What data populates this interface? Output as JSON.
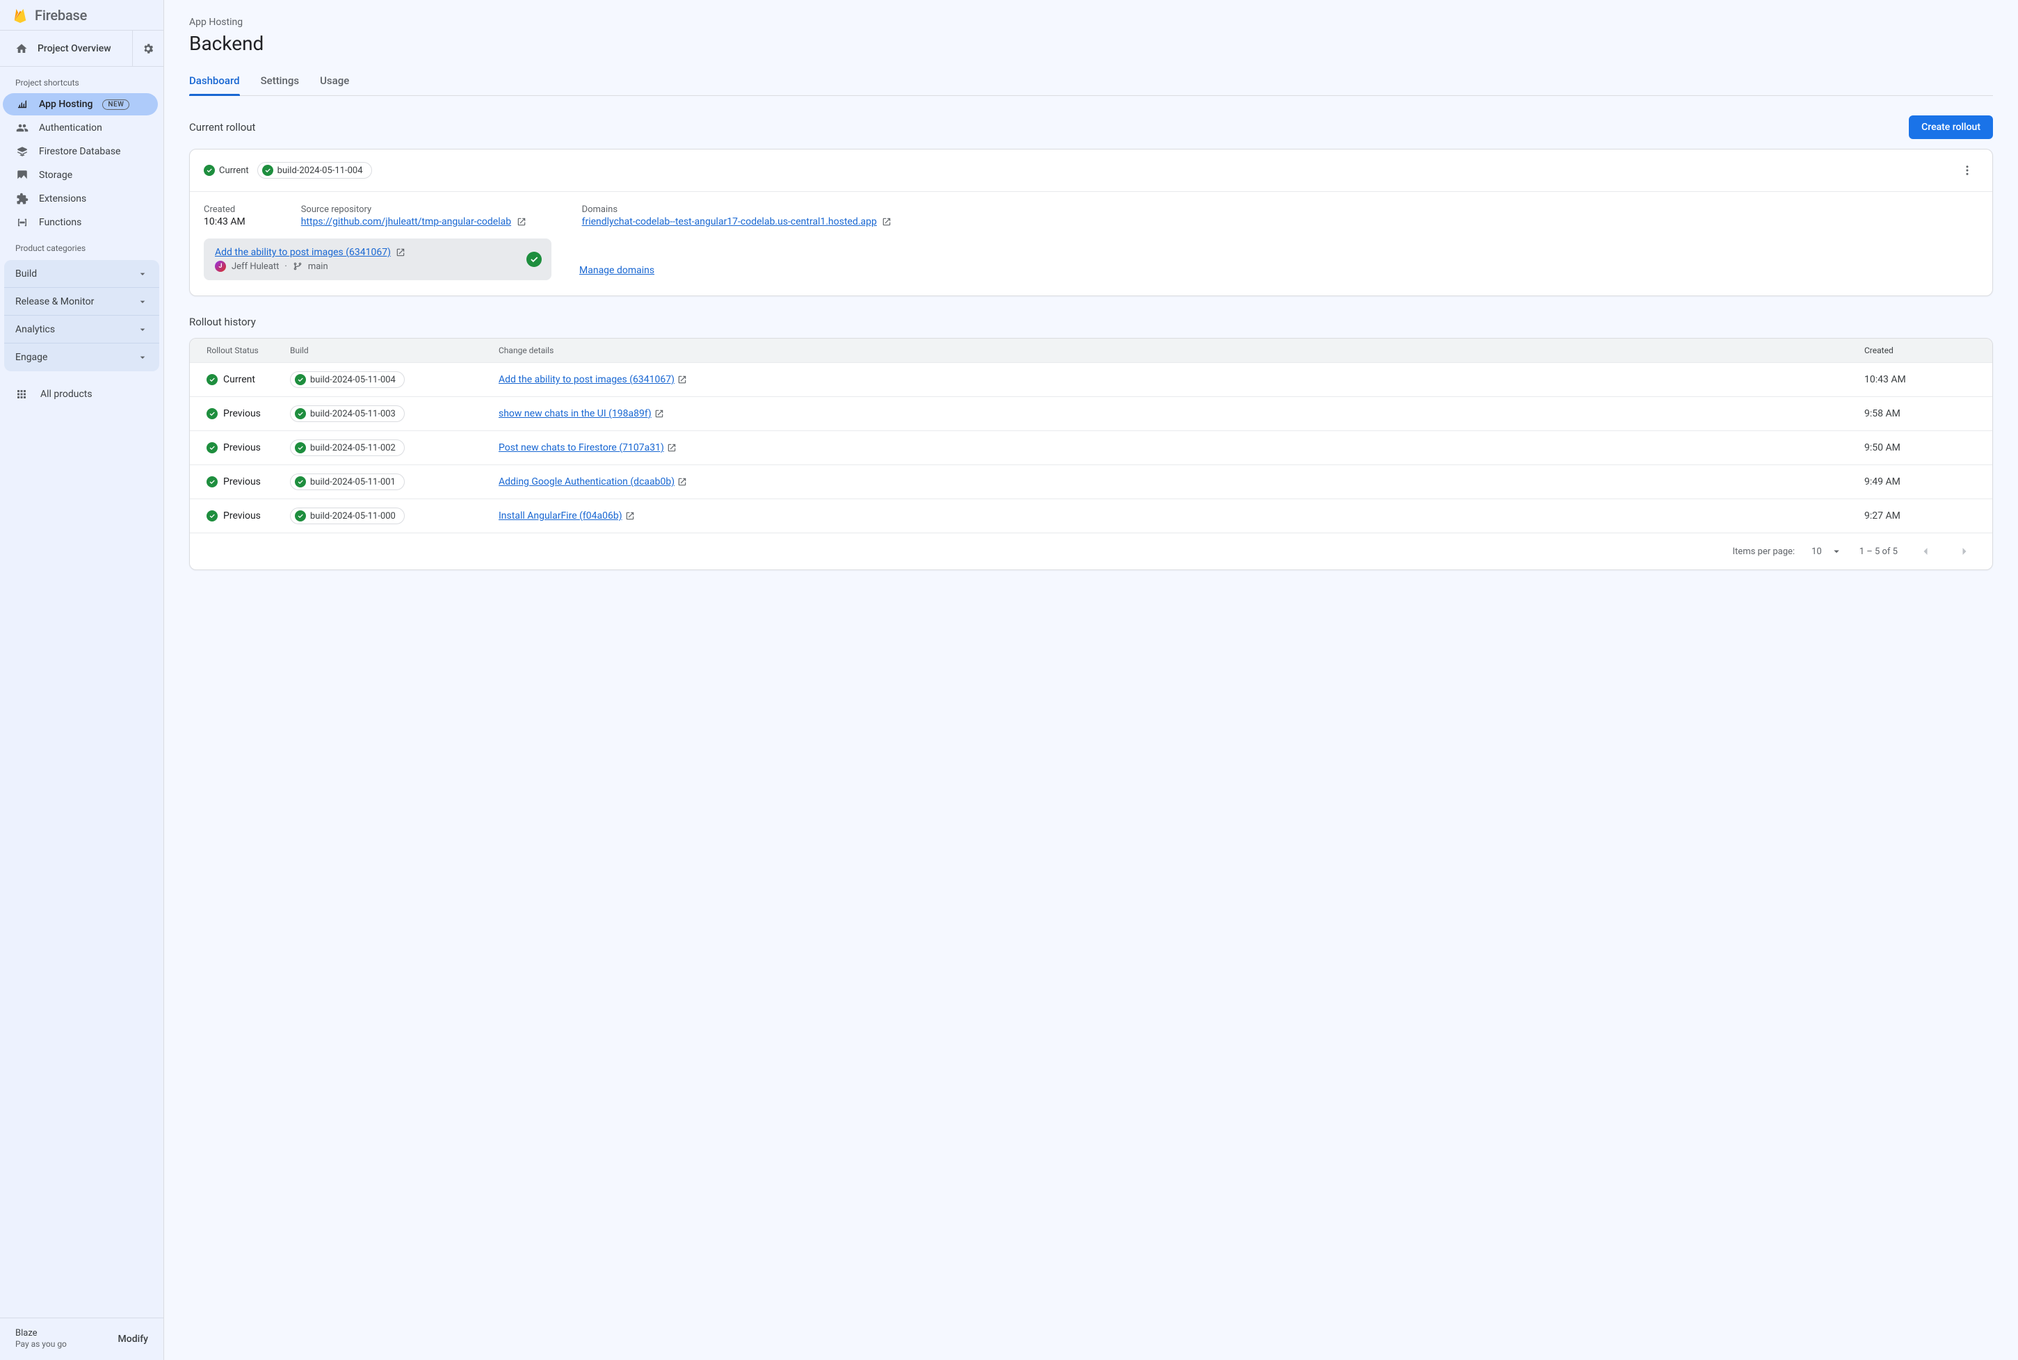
{
  "brand": "Firebase",
  "sidebar": {
    "projectOverview": "Project Overview",
    "shortcutsLabel": "Project shortcuts",
    "items": [
      {
        "label": "App Hosting",
        "badge": "NEW",
        "active": true
      },
      {
        "label": "Authentication"
      },
      {
        "label": "Firestore Database"
      },
      {
        "label": "Storage"
      },
      {
        "label": "Extensions"
      },
      {
        "label": "Functions"
      }
    ],
    "categoriesLabel": "Product categories",
    "categories": [
      "Build",
      "Release & Monitor",
      "Analytics",
      "Engage"
    ],
    "allProducts": "All products",
    "plan": {
      "name": "Blaze",
      "desc": "Pay as you go",
      "action": "Modify"
    }
  },
  "header": {
    "crumb": "App Hosting",
    "title": "Backend",
    "tabs": [
      "Dashboard",
      "Settings",
      "Usage"
    ],
    "activeTab": 0
  },
  "currentRollout": {
    "sectionTitle": "Current rollout",
    "createBtn": "Create rollout",
    "statusLabel": "Current",
    "build": "build-2024-05-11-004",
    "createdLabel": "Created",
    "createdTime": "10:43 AM",
    "repoLabel": "Source repository",
    "repoUrl": "https://github.com/jhuleatt/tmp-angular-codelab",
    "domainsLabel": "Domains",
    "domainUrl": "friendlychat-codelab--test-angular17-codelab.us-central1.hosted.app",
    "commit": {
      "title": "Add the ability to post images (6341067)",
      "author": "Jeff Huleatt",
      "branch": "main"
    },
    "manageDomains": "Manage domains"
  },
  "history": {
    "sectionTitle": "Rollout history",
    "columns": {
      "status": "Rollout Status",
      "build": "Build",
      "change": "Change details",
      "created": "Created"
    },
    "rows": [
      {
        "status": "Current",
        "build": "build-2024-05-11-004",
        "change": "Add the ability to post images (6341067)",
        "created": "10:43 AM"
      },
      {
        "status": "Previous",
        "build": "build-2024-05-11-003",
        "change": "show new chats in the UI (198a89f)",
        "created": "9:58 AM"
      },
      {
        "status": "Previous",
        "build": "build-2024-05-11-002",
        "change": "Post new chats to Firestore (7107a31)",
        "created": "9:50 AM"
      },
      {
        "status": "Previous",
        "build": "build-2024-05-11-001",
        "change": "Adding Google Authentication (dcaab0b)",
        "created": "9:49 AM"
      },
      {
        "status": "Previous",
        "build": "build-2024-05-11-000",
        "change": "Install AngularFire (f04a06b)",
        "created": "9:27 AM"
      }
    ],
    "itemsPerPageLabel": "Items per page:",
    "itemsPerPage": "10",
    "range": "1 – 5 of 5"
  }
}
